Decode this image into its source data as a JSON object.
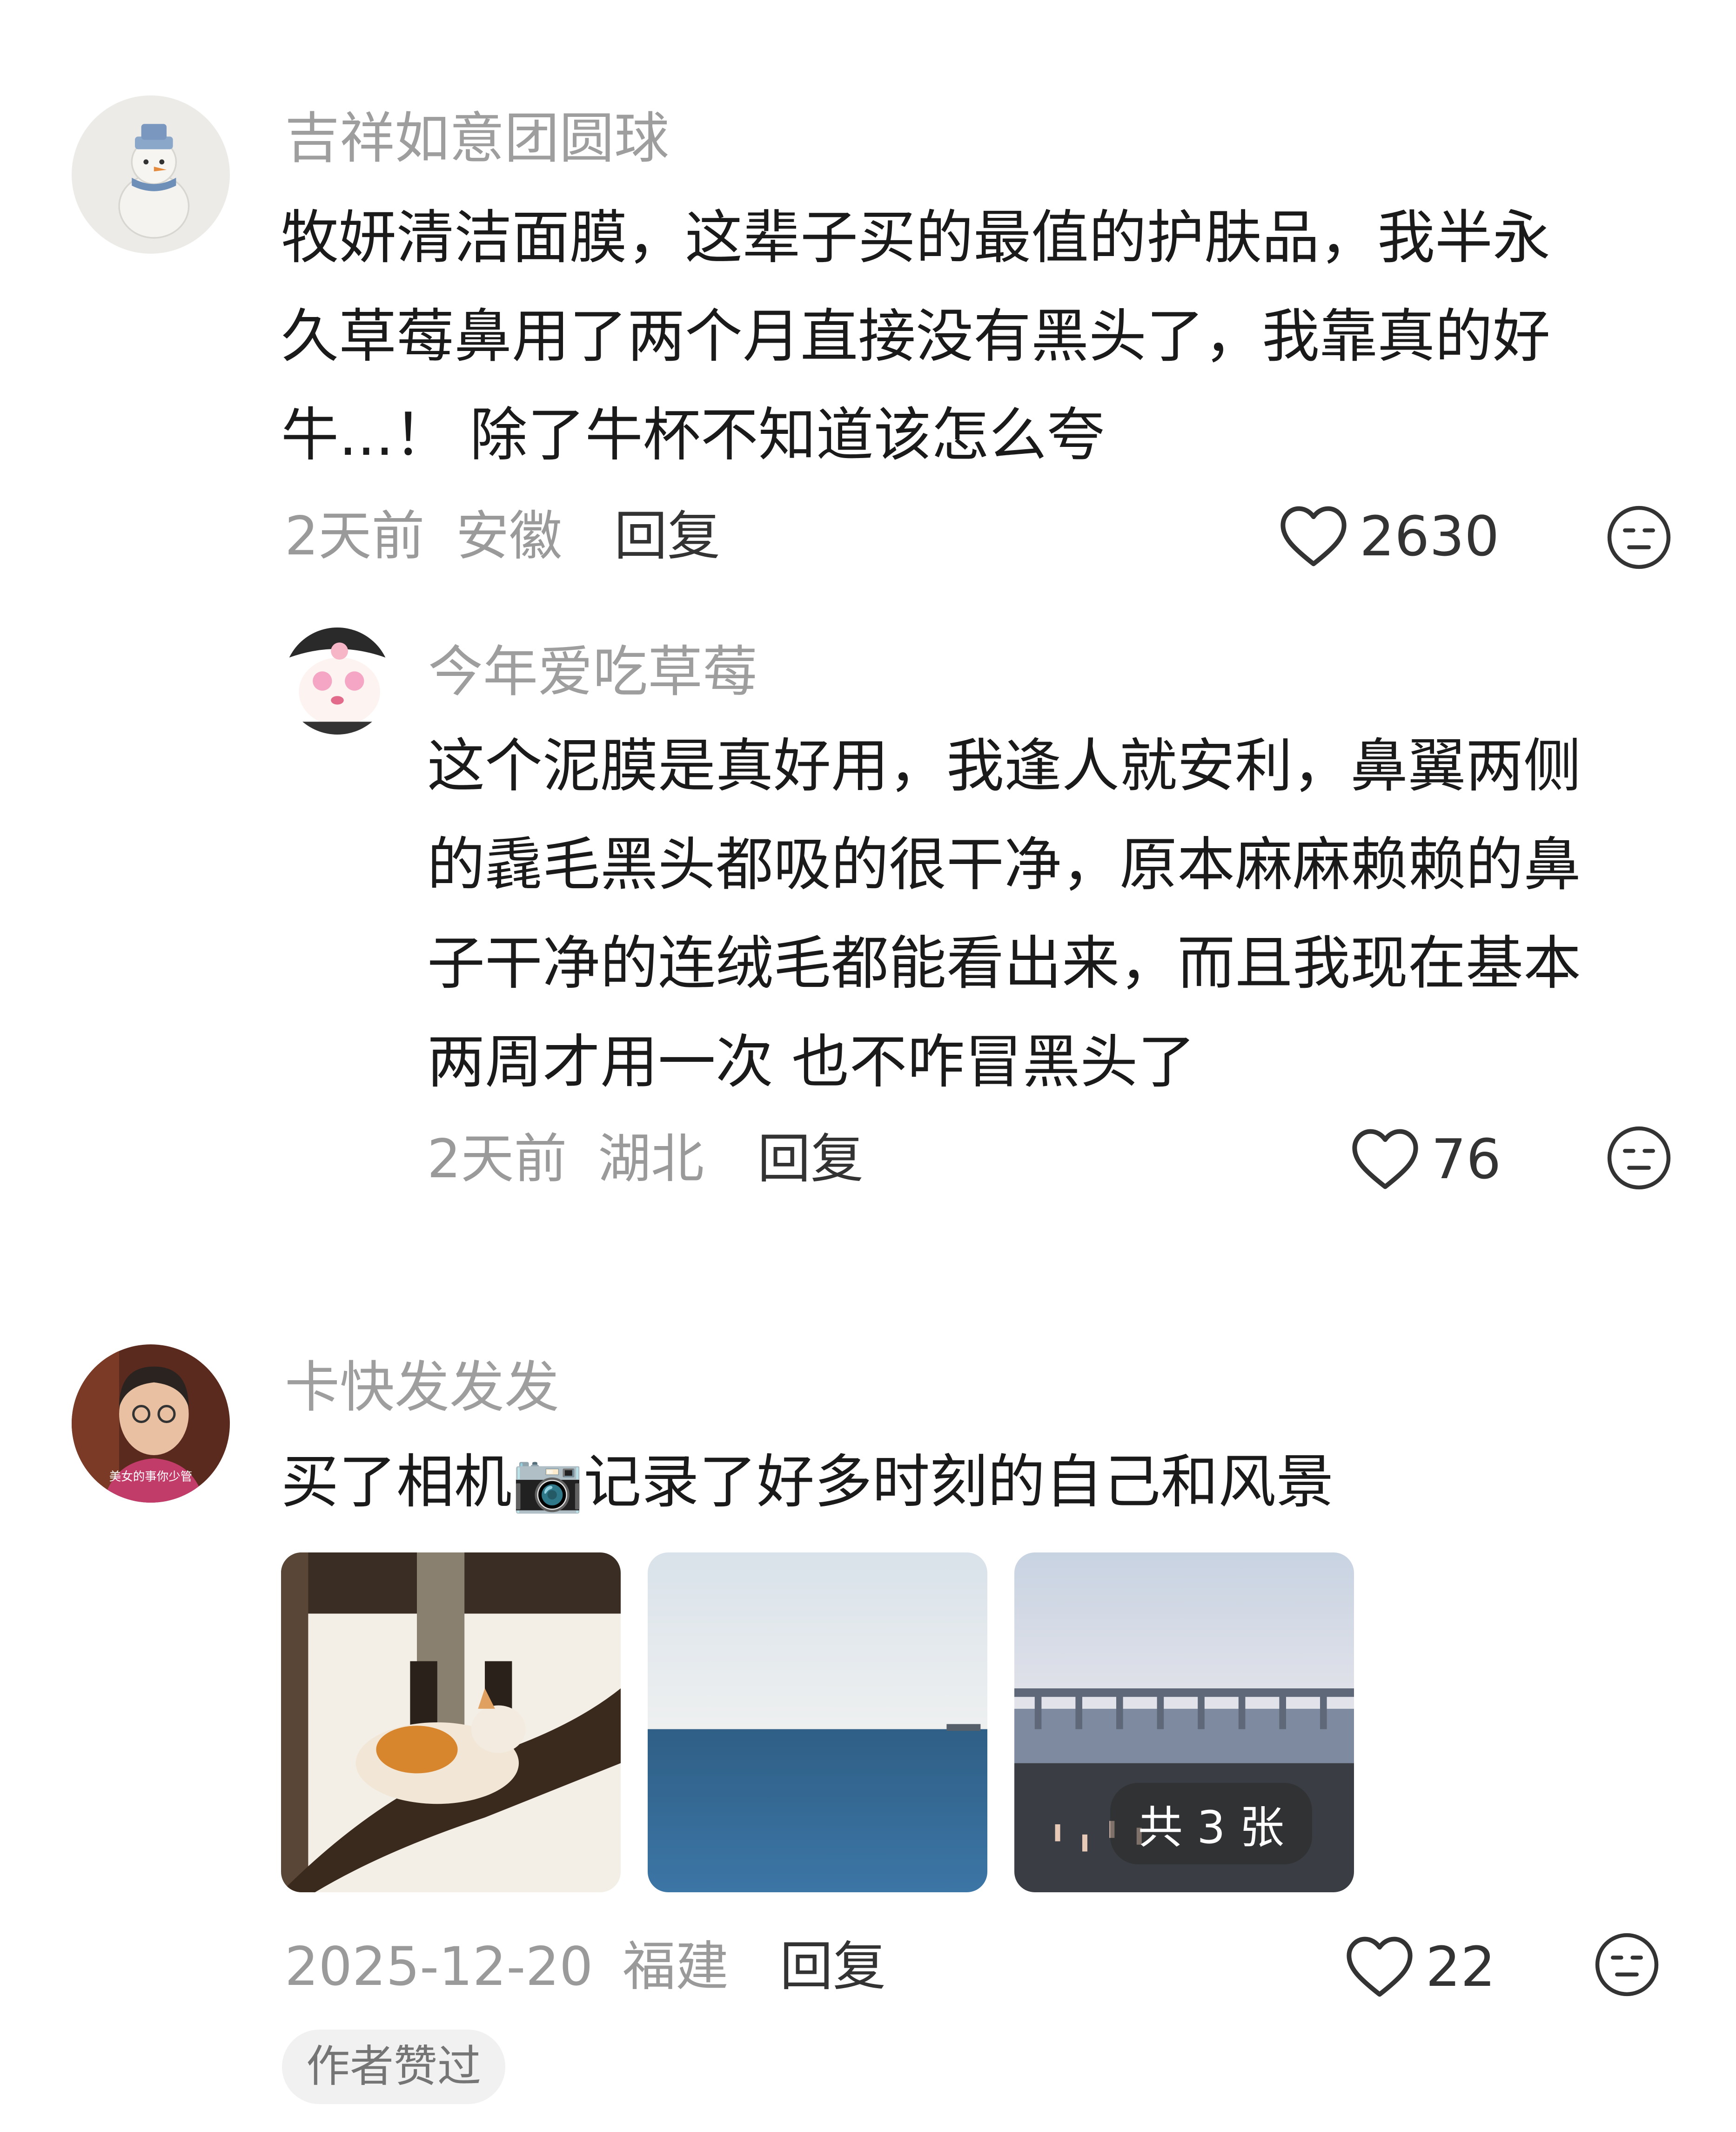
{
  "comments": [
    {
      "username": "吉祥如意团圆球",
      "lines": [
        "牧妍清洁面膜，这辈子买的最值的护肤品，我半永",
        "久草莓鼻用了两个月直接没有黑头了，我靠真的好",
        "牛...！ 除了牛杯不知道该怎么夸"
      ],
      "time": "2天前",
      "location": "安徽",
      "reply_label": "回复",
      "likes": "2630",
      "avatar_icon": "snowman-avatar-icon"
    },
    {
      "username": "今年爱吃草莓",
      "lines": [
        "这个泥膜是真好用，我逢人就安利，鼻翼两侧",
        "的毳毛黑头都吸的很干净，原本麻麻赖赖的鼻",
        "子干净的连绒毛都能看出来，而且我现在基本",
        "两周才用一次 也不咋冒黑头了"
      ],
      "time": "2天前",
      "location": "湖北",
      "reply_label": "回复",
      "likes": "76",
      "avatar_icon": "cartoon-avatar-icon"
    },
    {
      "username": "卡快发发发",
      "text_before_emoji": "买了相机",
      "emoji": "📷",
      "text_after_emoji": "记录了好多时刻的自己和风景",
      "time": "2025-12-20",
      "location": "福建",
      "reply_label": "回复",
      "likes": "22",
      "avatar_caption": "美女的事你少管",
      "image_count_label": "共 3 张",
      "author_badge": "作者赞过",
      "images": [
        "cat-on-branch-photo",
        "sea-photo",
        "bridge-beach-photo"
      ]
    }
  ]
}
